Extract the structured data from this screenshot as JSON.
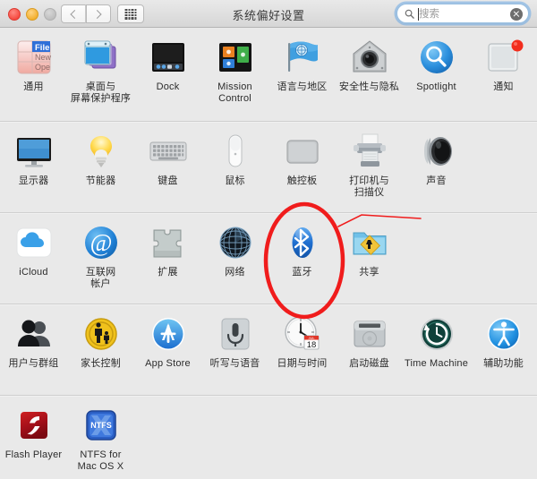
{
  "window": {
    "title": "系统偏好设置",
    "traffic_lights": [
      "close",
      "minimize",
      "zoom"
    ],
    "nav": {
      "back_label": "后退",
      "forward_label": "前进",
      "grid_label": "显示全部"
    }
  },
  "search": {
    "placeholder": "搜索",
    "value": "",
    "icon": "search-icon",
    "clear_icon": "clear-icon"
  },
  "sections": [
    {
      "name": "personal",
      "items": [
        {
          "label": "通用",
          "icon": "general-icon"
        },
        {
          "label": "桌面与\n屏幕保护程序",
          "icon": "desktop-screensaver-icon"
        },
        {
          "label": "Dock",
          "icon": "dock-icon"
        },
        {
          "label": "Mission\nControl",
          "icon": "mission-control-icon"
        },
        {
          "label": "语言与地区",
          "icon": "language-region-icon"
        },
        {
          "label": "安全性与隐私",
          "icon": "security-privacy-icon"
        },
        {
          "label": "Spotlight",
          "icon": "spotlight-icon"
        },
        {
          "label": "通知",
          "icon": "notifications-icon"
        }
      ]
    },
    {
      "name": "hardware",
      "items": [
        {
          "label": "显示器",
          "icon": "displays-icon"
        },
        {
          "label": "节能器",
          "icon": "energy-saver-icon"
        },
        {
          "label": "键盘",
          "icon": "keyboard-icon"
        },
        {
          "label": "鼠标",
          "icon": "mouse-icon"
        },
        {
          "label": "触控板",
          "icon": "trackpad-icon"
        },
        {
          "label": "打印机与\n扫描仪",
          "icon": "printers-scanners-icon"
        },
        {
          "label": "声音",
          "icon": "sound-icon"
        }
      ]
    },
    {
      "name": "internet-wireless",
      "items": [
        {
          "label": "iCloud",
          "icon": "icloud-icon"
        },
        {
          "label": "互联网\n帐户",
          "icon": "internet-accounts-icon"
        },
        {
          "label": "扩展",
          "icon": "extensions-icon"
        },
        {
          "label": "网络",
          "icon": "network-icon"
        },
        {
          "label": "蓝牙",
          "icon": "bluetooth-icon"
        },
        {
          "label": "共享",
          "icon": "sharing-icon"
        }
      ]
    },
    {
      "name": "system",
      "items": [
        {
          "label": "用户与群组",
          "icon": "users-groups-icon"
        },
        {
          "label": "家长控制",
          "icon": "parental-controls-icon"
        },
        {
          "label": "App Store",
          "icon": "app-store-icon"
        },
        {
          "label": "听写与语音",
          "icon": "dictation-speech-icon"
        },
        {
          "label": "日期与时间",
          "icon": "date-time-icon"
        },
        {
          "label": "启动磁盘",
          "icon": "startup-disk-icon"
        },
        {
          "label": "Time Machine",
          "icon": "time-machine-icon"
        },
        {
          "label": "辅助功能",
          "icon": "accessibility-icon"
        }
      ]
    },
    {
      "name": "other",
      "items": [
        {
          "label": "Flash Player",
          "icon": "flash-player-icon"
        },
        {
          "label": "NTFS for\nMac OS X",
          "icon": "ntfs-icon"
        }
      ]
    }
  ],
  "annotation": {
    "color": "#f01c1c",
    "target": "蓝牙",
    "shapes": [
      "ellipse",
      "pointer-line"
    ]
  },
  "date_icon": {
    "month": "JUL",
    "day": "18"
  },
  "ntfs_icon_text": "NTFS"
}
